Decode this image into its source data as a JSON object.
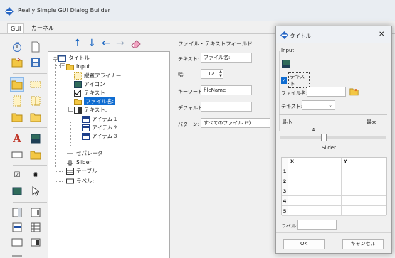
{
  "app": {
    "title": "Really Simple GUI Dialog Builder",
    "tabs": [
      "GUI",
      "カーネル"
    ]
  },
  "tree": {
    "items": [
      {
        "label": "タイトル"
      },
      {
        "label": "Input"
      },
      {
        "label": "縦置アライナー"
      },
      {
        "label": "アイコン"
      },
      {
        "label": "テキスト"
      },
      {
        "label": "ファイル名:",
        "selected": true
      },
      {
        "label": "テキスト:"
      },
      {
        "label": "アイテム１"
      },
      {
        "label": "アイテム２"
      },
      {
        "label": "アイテム３"
      },
      {
        "label": "セパレータ"
      },
      {
        "label": "Slider"
      },
      {
        "label": "テーブル"
      },
      {
        "label": "ラベル:"
      }
    ]
  },
  "properties": {
    "section_title": "ファイル・テキストフィールド",
    "text_label": "テキスト:",
    "text_value": "ファイル名:",
    "width_label": "幅:",
    "width_value": "12",
    "keyword_label": "キーワード:",
    "keyword_value": "fileName",
    "default_label": "デフォルト:",
    "default_value": "",
    "pattern_label": "パターン:",
    "pattern_value": "すべてのファイル (*)"
  },
  "dialog": {
    "title": "タイトル",
    "group_label": "Input",
    "checkbox_label": "テキスト",
    "checkbox_checked": true,
    "file_label": "ファイル名:",
    "text_combo_label": "テキスト:",
    "min_label": "最小",
    "max_label": "最大",
    "slider_value": "4",
    "slider_level": 0.4,
    "slider_label": "Slider",
    "table_headers": [
      "X",
      "Y"
    ],
    "table_rows": [
      "1",
      "2",
      "3",
      "4",
      "5"
    ],
    "label_label": "ラベル:",
    "ok_label": "OK",
    "cancel_label": "キャンセル",
    "close_glyph": "✕"
  },
  "colors": {
    "accent": "#0f6cd1",
    "arrow": "#0f5fc0",
    "folder": "#f3c744"
  }
}
